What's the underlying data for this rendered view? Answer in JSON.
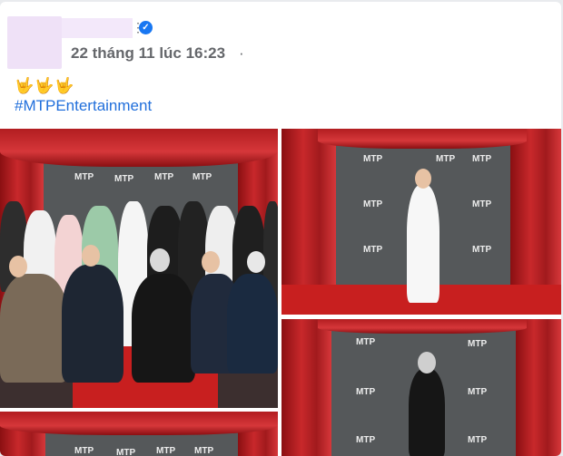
{
  "post": {
    "timestamp": "22 tháng 11 lúc 16:23",
    "separator": "·",
    "emojis": "🤟🤟🤟",
    "hashtag": "#MTPEntertainment",
    "verified_badge": "✓",
    "menu_dots": "⋮"
  },
  "photos": {
    "logo_text": "MTP"
  },
  "colors": {
    "curtain": "#c8282b",
    "backdrop": "#55585a",
    "carpet": "#c81f1f",
    "link": "#216fdb",
    "meta_text": "#65676b",
    "verified": "#1877f2"
  }
}
